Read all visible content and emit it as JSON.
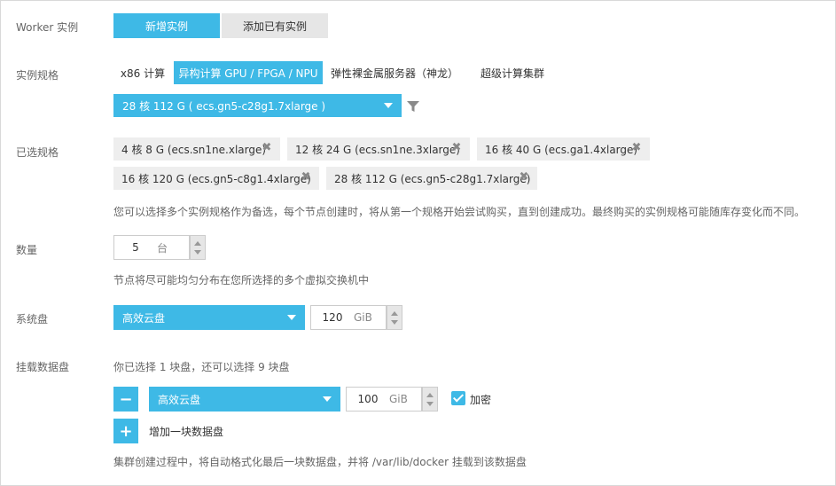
{
  "labels": {
    "worker": "Worker 实例",
    "spec": "实例规格",
    "selected": "已选规格",
    "count": "数量",
    "sysdisk": "系统盘",
    "datadisk": "挂载数据盘"
  },
  "worker_mode": {
    "new": "新增实例",
    "existing": "添加已有实例"
  },
  "spec_tabs": {
    "x86": "x86 计算",
    "hetero": "异构计算 GPU / FPGA / NPU",
    "bare": "弹性裸金属服务器（神龙）",
    "super": "超级计算集群"
  },
  "spec_select": {
    "value": "28 核 112 G ( ecs.gn5-c28g1.7xlarge )"
  },
  "chips": [
    "4 核 8 G (ecs.sn1ne.xlarge)",
    "12 核 24 G (ecs.sn1ne.3xlarge)",
    "16 核 40 G (ecs.ga1.4xlarge)",
    "16 核 120 G (ecs.gn5-c8g1.4xlarge)",
    "28 核 112 G (ecs.gn5-c28g1.7xlarge)"
  ],
  "chip_close": "✖",
  "spec_hint": "您可以选择多个实例规格作为备选，每个节点创建时，将从第一个规格开始尝试购买，直到创建成功。最终购买的实例规格可能随库存变化而不同。",
  "count": {
    "value": "5",
    "unit": "台",
    "hint": "节点将尽可能均匀分布在您所选择的多个虚拟交换机中"
  },
  "sysdisk": {
    "type": "高效云盘",
    "size": "120",
    "unit": "GiB"
  },
  "datadisk": {
    "summary": "你已选择 1 块盘，还可以选择 9 块盘",
    "type": "高效云盘",
    "size": "100",
    "unit": "GiB",
    "encrypt_label": "加密",
    "remove_glyph": "−",
    "add_glyph": "+",
    "add_label": "增加一块数据盘",
    "hint": "集群创建过程中，将自动格式化最后一块数据盘，并将 /var/lib/docker 挂载到该数据盘"
  },
  "colors": {
    "accent": "#3eb9e6",
    "chip_bg": "#eeeeee"
  },
  "icons": {
    "filter": "filter-icon",
    "close": "close-icon"
  }
}
